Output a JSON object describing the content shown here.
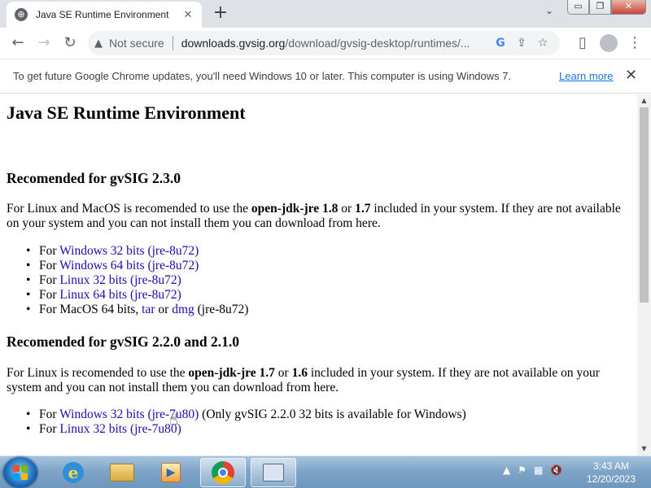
{
  "browser": {
    "tab_title": "Java SE Runtime Environment",
    "tab_close": "✕",
    "new_tab": "+",
    "tab_search": "⌄",
    "window_buttons": {
      "minimize": "▭",
      "restore": "❐",
      "close": "✕"
    },
    "nav": {
      "back": "←",
      "forward": "→",
      "reload": "↻"
    },
    "omnibox": {
      "security_icon": "▲",
      "security_label": "Not secure",
      "url_host": "downloads.gvsig.org",
      "url_path": "/download/gvsig-desktop/runtimes/...",
      "google_icon": "G",
      "share_icon": "⇪",
      "bookmark_icon": "☆"
    },
    "toolbar_icons": {
      "side_panel": "▯",
      "menu": "⋮"
    }
  },
  "infobar": {
    "message": "To get future Google Chrome updates, you'll need Windows 10 or later. This computer is using Windows 7.",
    "learn_more": "Learn more",
    "close": "✕"
  },
  "page": {
    "title": "Java SE Runtime Environment",
    "section1": {
      "heading": "Recomended for gvSIG 2.3.0",
      "para_start": "For Linux and MacOS is recomended to use the ",
      "pkg": "open-jdk-jre",
      "v1": "1.8",
      "or": " or ",
      "v2": "1.7",
      "para_end": " included in your system. If they are not available on your system and you can not install them you can download from here.",
      "items": [
        {
          "prefix": "For ",
          "link": "Windows 32 bits (jre-8u72)"
        },
        {
          "prefix": "For ",
          "link": "Windows 64 bits (jre-8u72)"
        },
        {
          "prefix": "For ",
          "link": "Linux 32 bits (jre-8u72)"
        },
        {
          "prefix": "For ",
          "link": "Linux 64 bits (jre-8u72)"
        }
      ],
      "mac_prefix": "For MacOS 64 bits, ",
      "mac_tar": "tar",
      "mac_or": " or ",
      "mac_dmg": "dmg",
      "mac_suffix": " (jre-8u72)"
    },
    "section2": {
      "heading": "Recomended for gvSIG 2.2.0 and 2.1.0",
      "para_start": "For Linux is recomended to use the ",
      "pkg": "open-jdk-jre",
      "v1": "1.7",
      "or": " or ",
      "v2": "1.6",
      "para_end": " included in your system. If they are not available on your system and you can not install them you can download from here.",
      "items": [
        {
          "prefix": "For ",
          "link": "Windows 32 bits (jre-7u80)",
          "suffix": " (Only gvSIG 2.2.0 32 bits is available for Windows)"
        },
        {
          "prefix": "For ",
          "link": "Linux 32 bits (jre-7u80)",
          "suffix": ""
        }
      ]
    }
  },
  "taskbar": {
    "apps": [
      "internet-explorer",
      "windows-explorer",
      "media-player",
      "google-chrome",
      "remote-desktop"
    ],
    "tray_icons": [
      "show-hidden-icons",
      "action-center-flag",
      "network",
      "volume-muted"
    ],
    "time": "3:43 AM",
    "date": "12/20/2023"
  }
}
